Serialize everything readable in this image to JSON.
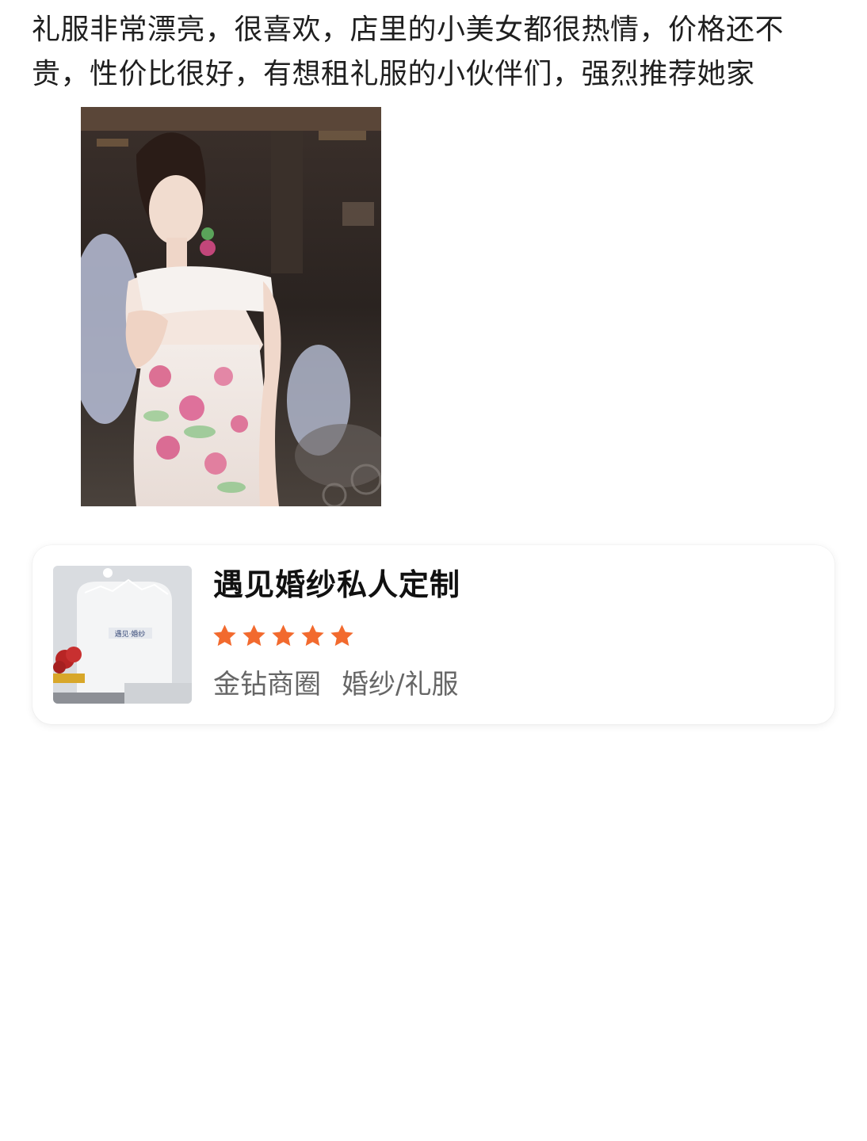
{
  "review": {
    "text": "礼服非常漂亮，很喜欢，店里的小美女都很热情，价格还不贵，性价比很好，有想租礼服的小伙伴们，强烈推荐她家"
  },
  "shop": {
    "name": "遇见婚纱私人定制",
    "rating_stars": 5,
    "star_color": "#f26a2e",
    "district": "金钻商圈",
    "category": "婚纱/礼服",
    "thumb_sign": "遇见·婚纱"
  }
}
